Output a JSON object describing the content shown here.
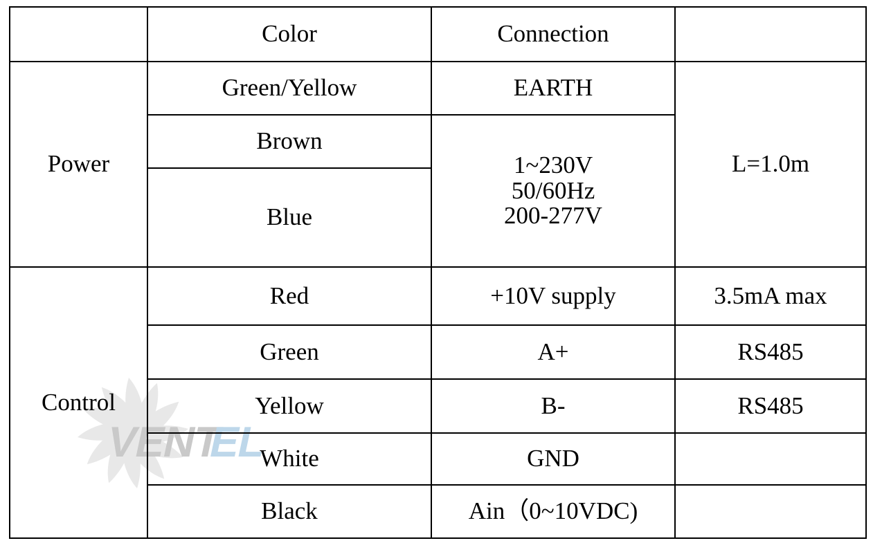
{
  "table": {
    "headers": {
      "group": "",
      "color": "Color",
      "connection": "Connection",
      "note": ""
    },
    "groups": [
      {
        "name": "Power",
        "note": "L=1.0m",
        "rows": [
          {
            "color": "Green/Yellow",
            "connection": "EARTH"
          },
          {
            "color": "Brown",
            "connection": ""
          },
          {
            "color": "Blue",
            "connection": ""
          }
        ],
        "merged_connection_lines": [
          "1~230V",
          "50/60Hz",
          "200-277V"
        ]
      },
      {
        "name": "Control",
        "rows": [
          {
            "color": "Red",
            "connection": "+10V supply",
            "note": "3.5mA max"
          },
          {
            "color": "Green",
            "connection": "A+",
            "note": "RS485"
          },
          {
            "color": "Yellow",
            "connection": "B-",
            "note": "RS485"
          },
          {
            "color": "White",
            "connection": "GND",
            "note": ""
          },
          {
            "color": "Black",
            "connection": "Ain（0~10VDC)",
            "note": ""
          }
        ]
      }
    ]
  },
  "watermark": {
    "text_primary": "VENT",
    "text_accent": "EL",
    "color_primary": "#c9c9c9",
    "color_accent": "#bdd7ea",
    "color_fan": "#e8e8e8"
  }
}
